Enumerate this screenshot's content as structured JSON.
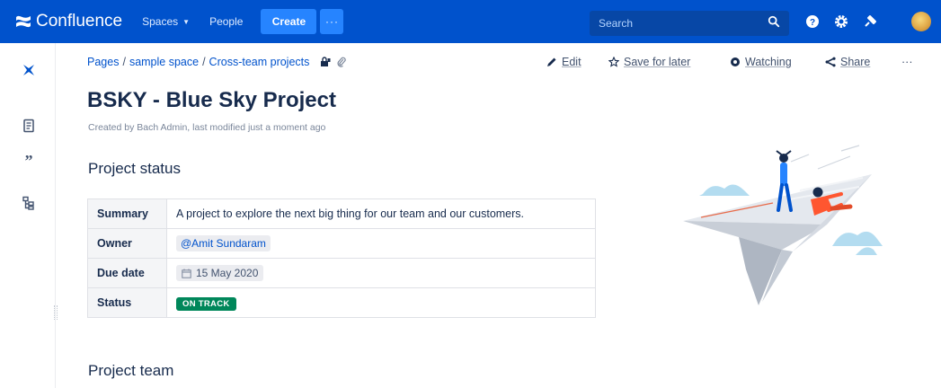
{
  "topnav": {
    "brand": "Confluence",
    "items": [
      {
        "label": "Spaces"
      },
      {
        "label": "People"
      }
    ],
    "create_label": "Create",
    "more_label": "···",
    "search_placeholder": "Search"
  },
  "breadcrumb": {
    "items": [
      "Pages",
      "sample space",
      "Cross-team projects"
    ],
    "separator": "/"
  },
  "actions": {
    "edit": "Edit",
    "save_for_later": "Save for later",
    "watching": "Watching",
    "share": "Share",
    "more": "···"
  },
  "page": {
    "title": "BSKY - Blue Sky Project",
    "byline": "Created by Bach Admin, last modified just a moment ago"
  },
  "project_status": {
    "heading": "Project status",
    "rows": [
      {
        "label": "Summary",
        "value": "A project to explore the next big thing for our team and our customers."
      },
      {
        "label": "Owner",
        "value": "@Amit Sundaram"
      },
      {
        "label": "Due date",
        "value": "15 May 2020"
      },
      {
        "label": "Status",
        "value": "ON TRACK"
      }
    ]
  },
  "project_team": {
    "heading": "Project team"
  },
  "colors": {
    "nav_bg": "#0052cc",
    "create_bg": "#2684ff",
    "status_green": "#00875a",
    "link": "#0052cc"
  }
}
